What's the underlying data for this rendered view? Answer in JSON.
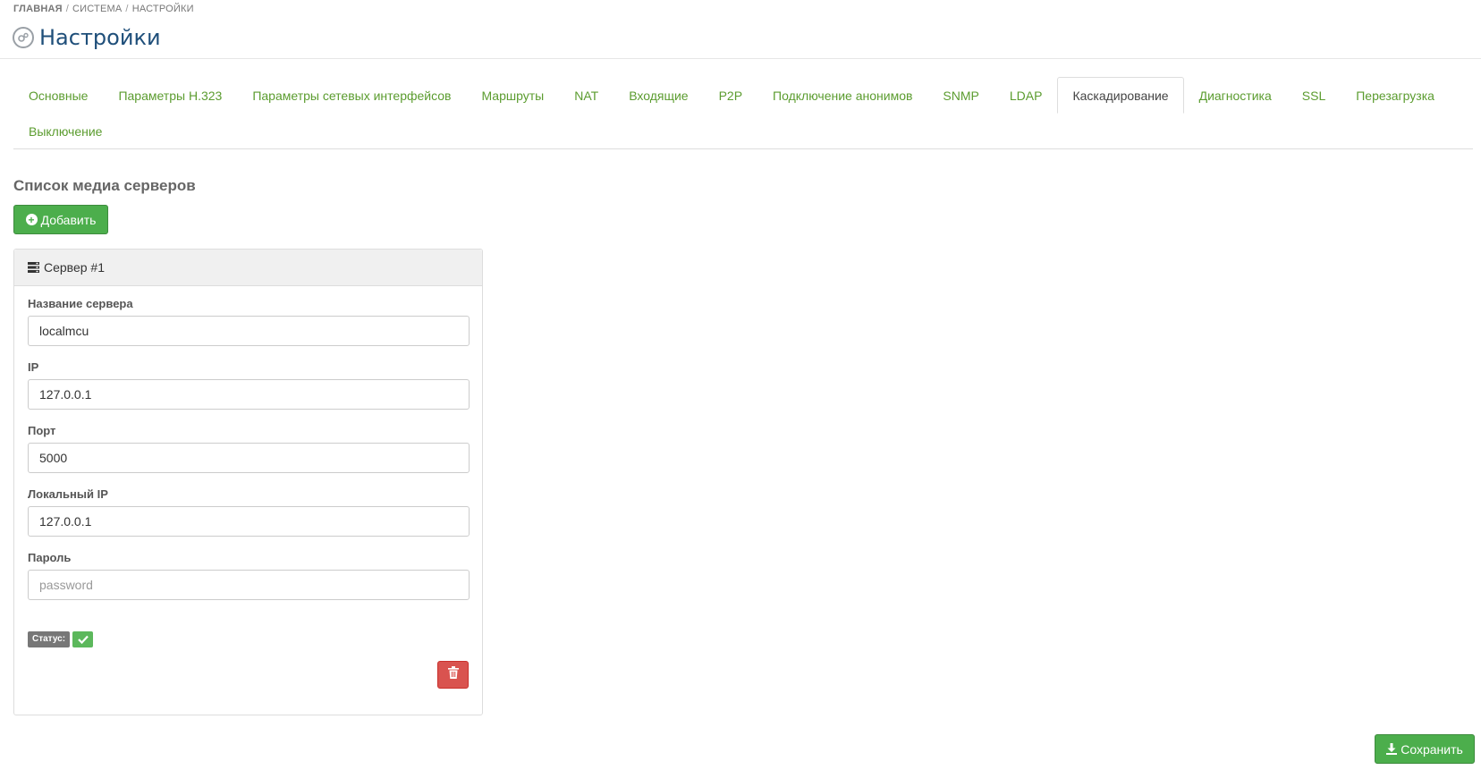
{
  "breadcrumb": {
    "items": [
      "ГЛАВНАЯ",
      "СИСТЕМА",
      "НАСТРОЙКИ"
    ],
    "separator": "/"
  },
  "page": {
    "title": "Настройки",
    "icon": "gear-circle-icon"
  },
  "tabs": [
    {
      "label": "Основные",
      "active": false
    },
    {
      "label": "Параметры H.323",
      "active": false
    },
    {
      "label": "Параметры сетевых интерфейсов",
      "active": false
    },
    {
      "label": "Маршруты",
      "active": false
    },
    {
      "label": "NAT",
      "active": false
    },
    {
      "label": "Входящие",
      "active": false
    },
    {
      "label": "P2P",
      "active": false
    },
    {
      "label": "Подключение анонимов",
      "active": false
    },
    {
      "label": "SNMP",
      "active": false
    },
    {
      "label": "LDAP",
      "active": false
    },
    {
      "label": "Каскадирование",
      "active": true
    },
    {
      "label": "Диагностика",
      "active": false
    },
    {
      "label": "SSL",
      "active": false
    },
    {
      "label": "Перезагрузка",
      "active": false
    },
    {
      "label": "Выключение",
      "active": false
    }
  ],
  "section": {
    "title": "Список медиа серверов",
    "add_label": "Добавить"
  },
  "server": {
    "heading": "Сервер #1",
    "fields": {
      "name": {
        "label": "Название сервера",
        "value": "localmcu"
      },
      "ip": {
        "label": "IP",
        "value": "127.0.0.1"
      },
      "port": {
        "label": "Порт",
        "value": "5000"
      },
      "local_ip": {
        "label": "Локальный IP",
        "value": "127.0.0.1"
      },
      "password": {
        "label": "Пароль",
        "value": "",
        "placeholder": "password"
      }
    },
    "status_label": "Статус:",
    "status_ok": true
  },
  "save_label": "Сохранить",
  "colors": {
    "accent_green": "#4cae4c",
    "tab_link": "#5b9c2f",
    "danger": "#d9534f",
    "title_blue": "#1f4f7a"
  }
}
